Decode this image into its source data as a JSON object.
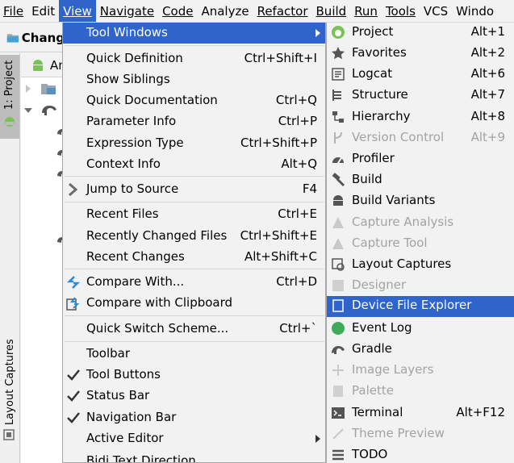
{
  "menubar": {
    "items": [
      {
        "label": "File"
      },
      {
        "label": "Edit"
      },
      {
        "label": "View"
      },
      {
        "label": "Navigate"
      },
      {
        "label": "Code"
      },
      {
        "label": "Analyze"
      },
      {
        "label": "Refactor"
      },
      {
        "label": "Build"
      },
      {
        "label": "Run"
      },
      {
        "label": "Tools"
      },
      {
        "label": "VCS"
      },
      {
        "label": "Windo"
      }
    ],
    "active_index": 2
  },
  "breadcrumb": {
    "label": "Chang"
  },
  "left_stripe": {
    "project_tab": "1: Project",
    "layout_captures_tab": "Layout Captures"
  },
  "project_panel": {
    "header_fragment": "An"
  },
  "view_menu": {
    "items": [
      {
        "label": "Tool Windows",
        "shortcut": "",
        "submenu": true,
        "highlighted": true
      },
      {
        "label": "Quick Definition",
        "shortcut": "Ctrl+Shift+I"
      },
      {
        "label": "Show Siblings",
        "shortcut": ""
      },
      {
        "label": "Quick Documentation",
        "shortcut": "Ctrl+Q"
      },
      {
        "label": "Parameter Info",
        "shortcut": "Ctrl+P"
      },
      {
        "label": "Expression Type",
        "shortcut": "Ctrl+Shift+P"
      },
      {
        "label": "Context Info",
        "shortcut": "Alt+Q"
      },
      {
        "label": "Jump to Source",
        "shortcut": "F4"
      },
      {
        "label": "Recent Files",
        "shortcut": "Ctrl+E"
      },
      {
        "label": "Recently Changed Files",
        "shortcut": "Ctrl+Shift+E"
      },
      {
        "label": "Recent Changes",
        "shortcut": "Alt+Shift+C"
      },
      {
        "label": "Compare With...",
        "shortcut": "Ctrl+D"
      },
      {
        "label": "Compare with Clipboard",
        "shortcut": ""
      },
      {
        "label": "Quick Switch Scheme...",
        "shortcut": "Ctrl+`"
      },
      {
        "label": "Toolbar",
        "shortcut": ""
      },
      {
        "label": "Tool Buttons",
        "shortcut": "",
        "checked": true
      },
      {
        "label": "Status Bar",
        "shortcut": "",
        "checked": true
      },
      {
        "label": "Navigation Bar",
        "shortcut": "",
        "checked": true
      },
      {
        "label": "Active Editor",
        "shortcut": "",
        "submenu": true
      },
      {
        "label": "Bidi Text Direction",
        "shortcut": ""
      }
    ]
  },
  "tool_windows_menu": {
    "items": [
      {
        "label": "Project",
        "shortcut": "Alt+1",
        "icon": "android-project-icon"
      },
      {
        "label": "Favorites",
        "shortcut": "Alt+2",
        "icon": "star-icon"
      },
      {
        "label": "Logcat",
        "shortcut": "Alt+6",
        "icon": "logcat-icon"
      },
      {
        "label": "Structure",
        "shortcut": "Alt+7",
        "icon": "structure-icon"
      },
      {
        "label": "Hierarchy",
        "shortcut": "Alt+8",
        "icon": "hierarchy-icon"
      },
      {
        "label": "Version Control",
        "shortcut": "Alt+9",
        "icon": "version-control-icon",
        "disabled": true
      },
      {
        "label": "Profiler",
        "shortcut": "",
        "icon": "profiler-icon"
      },
      {
        "label": "Build",
        "shortcut": "",
        "icon": "hammer-icon"
      },
      {
        "label": "Build Variants",
        "shortcut": "",
        "icon": "android-icon"
      },
      {
        "label": "Capture Analysis",
        "shortcut": "",
        "icon": "capture-analysis-icon",
        "disabled": true
      },
      {
        "label": "Capture Tool",
        "shortcut": "",
        "icon": "capture-tool-icon",
        "disabled": true
      },
      {
        "label": "Layout Captures",
        "shortcut": "",
        "icon": "layout-captures-icon"
      },
      {
        "label": "Designer",
        "shortcut": "",
        "icon": "designer-icon",
        "disabled": true
      },
      {
        "label": "Device File Explorer",
        "shortcut": "",
        "icon": "device-file-explorer-icon",
        "highlighted": true
      },
      {
        "label": "Event Log",
        "shortcut": "",
        "icon": "event-log-icon"
      },
      {
        "label": "Gradle",
        "shortcut": "",
        "icon": "gradle-icon"
      },
      {
        "label": "Image Layers",
        "shortcut": "",
        "icon": "image-layers-icon",
        "disabled": true
      },
      {
        "label": "Palette",
        "shortcut": "",
        "icon": "palette-icon",
        "disabled": true
      },
      {
        "label": "Terminal",
        "shortcut": "Alt+F12",
        "icon": "terminal-icon"
      },
      {
        "label": "Theme Preview",
        "shortcut": "",
        "icon": "theme-preview-icon",
        "disabled": true
      },
      {
        "label": "TODO",
        "shortcut": "",
        "icon": "todo-icon"
      }
    ]
  },
  "colors": {
    "highlight": "#2f65ca",
    "disabled_text": "#a3a3a3",
    "android_green": "#78c257",
    "event_log_green": "#3dab5a"
  }
}
